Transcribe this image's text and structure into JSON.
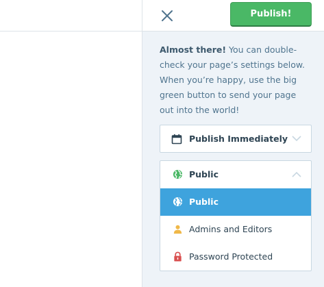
{
  "header": {
    "publish_label": "Publish!",
    "close_icon": "close-icon"
  },
  "intro": {
    "lead": "Almost there!",
    "body": " You can double-check your page’s settings below. When you’re happy, use the big green button to send your page out into the world!"
  },
  "schedule": {
    "label": "Publish Immediately",
    "icon": "calendar-icon"
  },
  "visibility": {
    "selected_label": "Public",
    "expanded": true,
    "options": [
      {
        "label": "Public",
        "icon": "globe-icon",
        "selected": true
      },
      {
        "label": "Admins and Editors",
        "icon": "person-icon",
        "selected": false
      },
      {
        "label": "Password Protected",
        "icon": "lock-icon",
        "selected": false
      }
    ]
  },
  "colors": {
    "publish_green": "#4ab866",
    "selected_blue": "#3ea3dd",
    "globe_green": "#4ab866",
    "person_yellow": "#f0b849",
    "lock_red": "#d94f4f",
    "panel_bg": "#eef3f8"
  }
}
